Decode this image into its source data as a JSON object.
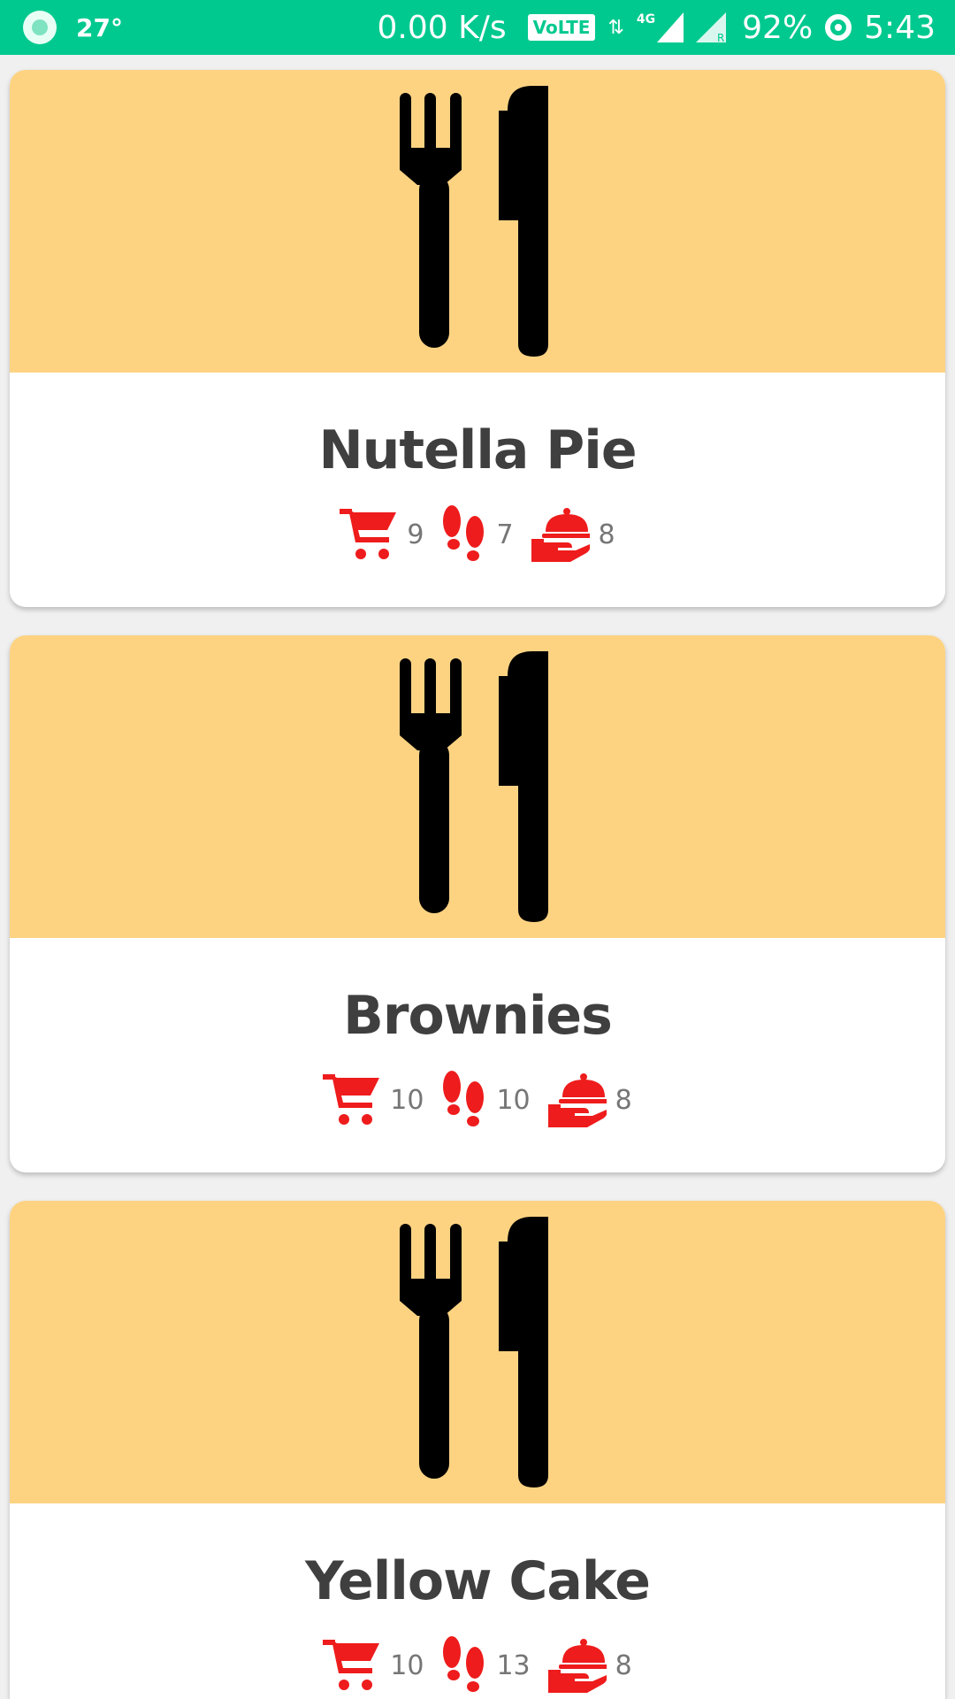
{
  "status_bar": {
    "temperature": "27°",
    "network_speed": "0.00 K/s",
    "volte": "VoLTE",
    "network_type": "4G",
    "battery": "92%",
    "time": "5:43"
  },
  "colors": {
    "status_bar": "#00c98f",
    "banner": "#fdd382",
    "icon_red": "#ee1c1c",
    "title": "#3f3f3f"
  },
  "recipes": [
    {
      "name": "Nutella Pie",
      "image_icon": "fork-knife-icon",
      "stats": {
        "cart": "9",
        "steps": "7",
        "servings": "8"
      }
    },
    {
      "name": "Brownies",
      "image_icon": "fork-knife-icon",
      "stats": {
        "cart": "10",
        "steps": "10",
        "servings": "8"
      }
    },
    {
      "name": "Yellow Cake",
      "image_icon": "fork-knife-icon",
      "stats": {
        "cart": "10",
        "steps": "13",
        "servings": "8"
      }
    }
  ]
}
